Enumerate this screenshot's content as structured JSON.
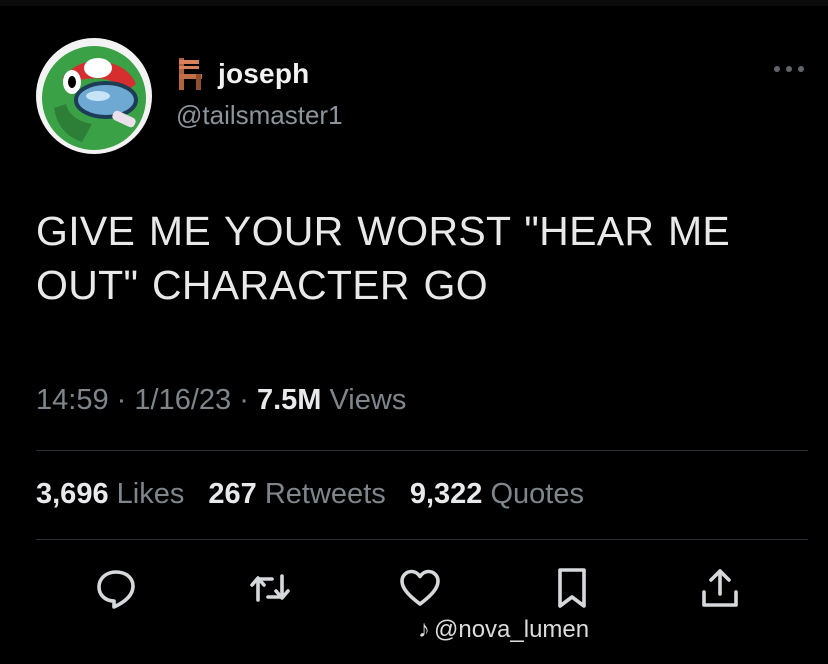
{
  "author": {
    "display_name": "joseph",
    "handle": "@tailsmaster1",
    "name_icon": "chair-icon",
    "avatar_icon": "among-us-crewmate-avatar"
  },
  "tweet": {
    "text": "GIVE ME YOUR WORST \"HEAR ME OUT\" CHARACTER GO"
  },
  "meta": {
    "time": "14:59",
    "separator": "·",
    "date": "1/16/23",
    "views_count": "7.5M",
    "views_label": "Views"
  },
  "stats": {
    "likes_count": "3,696",
    "likes_label": "Likes",
    "retweets_count": "267",
    "retweets_label": "Retweets",
    "quotes_count": "9,322",
    "quotes_label": "Quotes"
  },
  "actions": [
    {
      "icon": "reply-icon"
    },
    {
      "icon": "retweet-icon"
    },
    {
      "icon": "like-icon"
    },
    {
      "icon": "bookmark-icon"
    },
    {
      "icon": "share-icon"
    }
  ],
  "watermark": {
    "logo": "tiktok-icon",
    "text": "@nova_lumen"
  },
  "colors": {
    "background": "#000000",
    "text_primary": "#e7e9ea",
    "text_secondary": "#7e868c",
    "divider": "#2a2e32"
  }
}
